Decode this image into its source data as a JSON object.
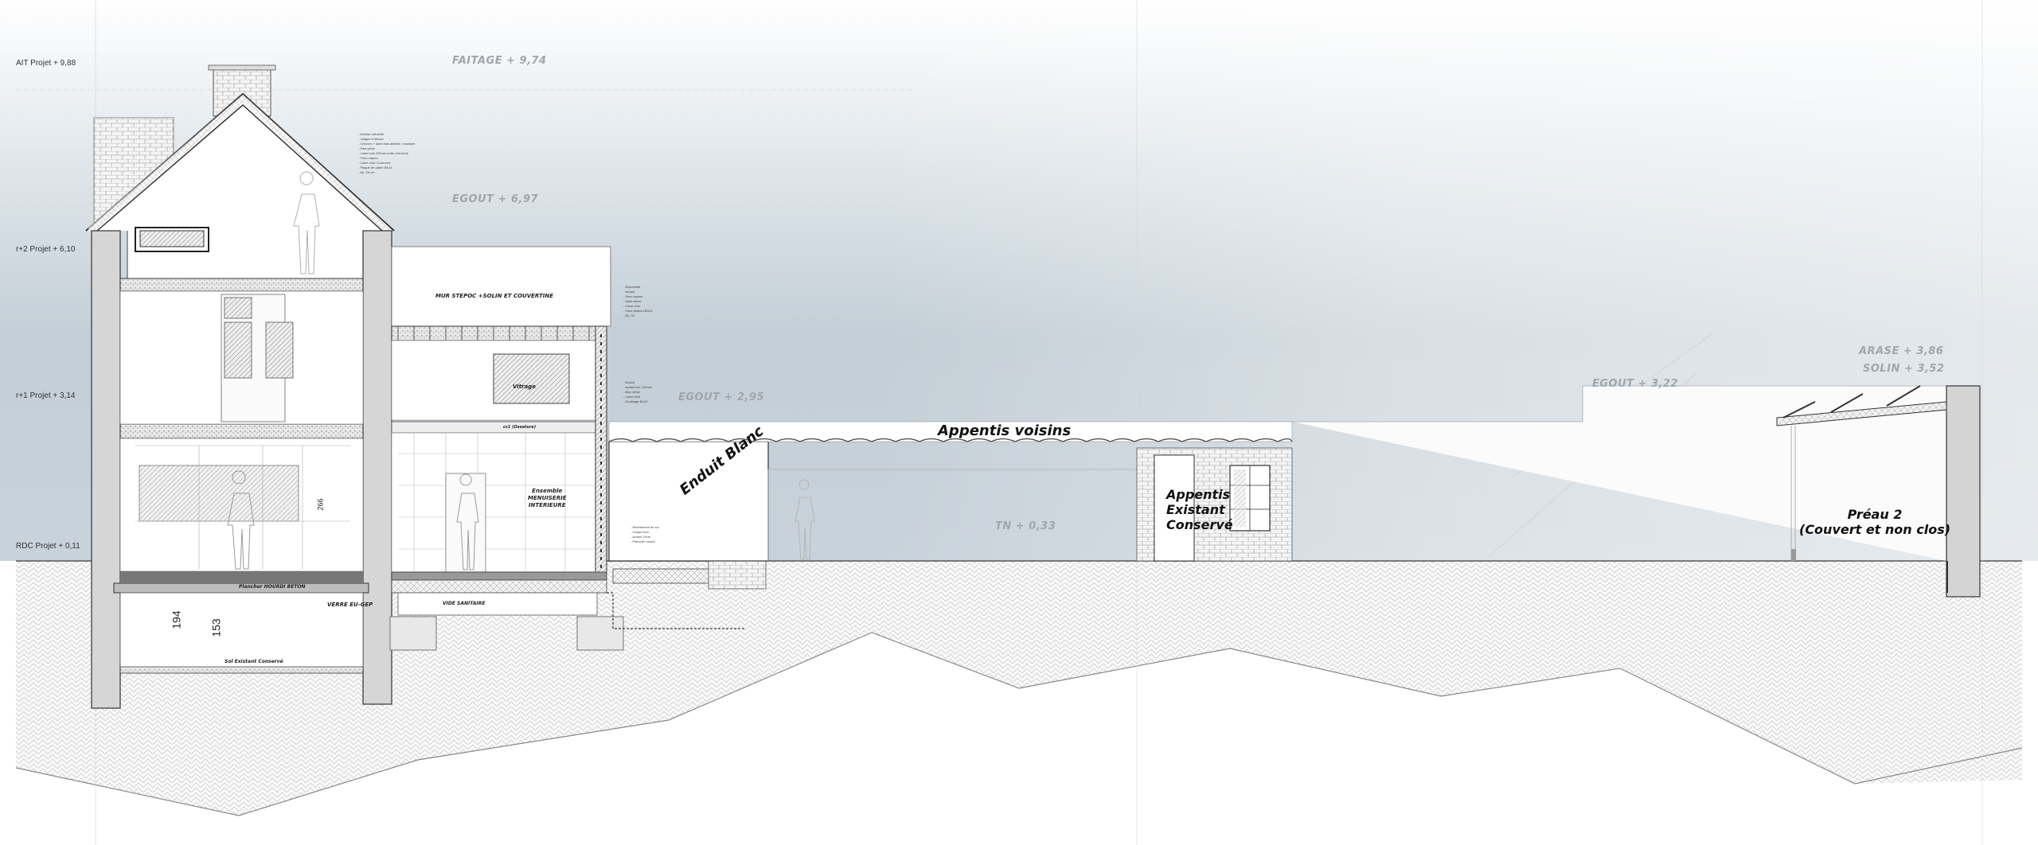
{
  "levels": {
    "faitage": "AIT Projet + 9,88",
    "r2": "r+2 Projet + 6,10",
    "r1": "r+1 Projet + 3,14",
    "rdc": "RDC Projet + 0,11"
  },
  "altitudes": {
    "faitage": "FAITAGE + 9,74",
    "egout1": "EGOUT + 6,97",
    "egout2": "EGOUT + 2,95",
    "egout3": "EGOUT + 3,22",
    "arase": "ARASE + 3,86",
    "solin": "SOLIN + 3,52",
    "tn": "TN + 0,33"
  },
  "labels": {
    "appentis_voisins": "Appentis voisins",
    "enduit_blanc": "Enduit Blanc",
    "appentis_existant": "Appentis\nExistant\nConservé",
    "preau": "Préau 2\n(Couvert et non clos)",
    "mur_stepoc": "MUR STEPOC +SOLIN ET COUVERTINE",
    "ensemble_menuiserie": "Ensemble\nMENUISERIE\nINTERIEURE",
    "plancher": "Plancher HOURDI BETON",
    "vide_sanitaire": "VIDE SANITAIRE",
    "sol_existant": "Sol Existant Conservé",
    "verre_eu_gep": "VERRE EU-GEP",
    "vitrage": "Vitrage",
    "ensemble2": "cc1 (Ossature)"
  },
  "dimensions": {
    "d194": "194",
    "d153": "153",
    "d266": "266"
  },
  "notes": {
    "roof": "- Ardoise naturelle\n- Voliges & liteaux\n- Chevron + laine bois ailettes / ossature\n- Pare-pluie\n- Laine bois 220mm entre chevrons\n- Frein vapeur\n- Lame d'air / fourrures\n- Plaque de plâtre BA13\n- Ep. 28 cm",
    "flat_roof": "- Etanchéité\n- Isolant\n- Pare-vapeur\n- Dalle béton\n- Lame d'air\n- Faux plafond BA13\n- Ep. 32",
    "wall": "- Enduit\n- Isolant ext. 140mm\n- Bloc béton\n- Lame d'air\n- Doublage BA13",
    "floor": "- Revêtement de sol\n- Chape 5cm\n- Isolant 10cm\n- Plancher hourdi"
  },
  "colors": {
    "sky_top": "#ffffff",
    "sky_bottom": "#c3ced6",
    "ground_line": "#555555",
    "hatch": "#c8c8c8"
  }
}
